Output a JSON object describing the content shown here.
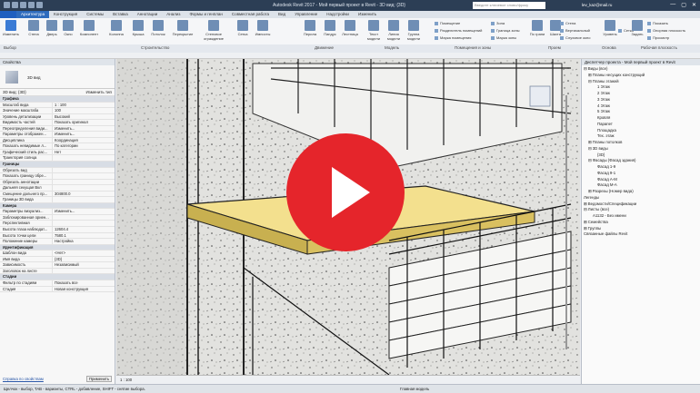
{
  "titlebar": {
    "title": "Autodesk Revit 2017 -    Мой первый проект в Revit - 3D вид: {3D}",
    "search_placeholder": "Введите ключевое слово/фразу",
    "user": "lev_kaz@mail.ru",
    "min": "—",
    "max": "▢",
    "close": "✕"
  },
  "tabs": [
    "Архитектура",
    "Конструкция",
    "Системы",
    "Вставка",
    "Аннотации",
    "Анализ",
    "Формы и генплан",
    "Совместная работа",
    "Вид",
    "Управление",
    "Надстройки",
    "Изменить"
  ],
  "ribbon": {
    "modify": "Изменить",
    "buttons": [
      "Стена",
      "Дверь",
      "Окно",
      "Компонент",
      "Колонна",
      "Крыша",
      "Потолок",
      "Перекрытие",
      "Стеновое ограждение",
      "Сетка",
      "Импосты",
      "Перила",
      "Пандус",
      "Лестница",
      "Текст модели",
      "Линия модели",
      "Группа модели",
      "Помещение",
      "Разделитель помещений",
      "Марка помещения",
      "Зона",
      "Граница зоны",
      "Марка зоны",
      "По грани",
      "Шахта",
      "Стена",
      "Вертикальный",
      "Слуховое окно",
      "Уровень",
      "Сетка",
      "Задать",
      "Показать",
      "Опорная плоскость",
      "Просмотр"
    ],
    "panels": [
      "Выбор",
      "Строительство",
      "Движение",
      "Модель",
      "Помещения и зоны",
      "Проем",
      "Основа",
      "Рабочая плоскость"
    ]
  },
  "properties": {
    "header": "Свойства",
    "type_name": "3D вид",
    "view_selector": "3D вид: {3D}",
    "edit_type": "Изменить тип",
    "rows": [
      {
        "k": "Графика",
        "v": "",
        "group": true
      },
      {
        "k": "Масштаб вида",
        "v": "1 : 100"
      },
      {
        "k": "Значение масштаба",
        "v": "100"
      },
      {
        "k": "Уровень детализации",
        "v": "Высокий"
      },
      {
        "k": "Видимость частей",
        "v": "Показать оригинал"
      },
      {
        "k": "Переопределения види...",
        "v": "Изменить..."
      },
      {
        "k": "Параметры отображен...",
        "v": "Изменить..."
      },
      {
        "k": "Дисциплина",
        "v": "Координация"
      },
      {
        "k": "Показать невидимые л...",
        "v": "По категории"
      },
      {
        "k": "Графический стиль рас...",
        "v": "Нет"
      },
      {
        "k": "Траектория солнца",
        "v": ""
      },
      {
        "k": "Границы",
        "v": "",
        "group": true
      },
      {
        "k": "Обрезать вид",
        "v": ""
      },
      {
        "k": "Показать границу обре...",
        "v": ""
      },
      {
        "k": "Обрезать аннотации",
        "v": ""
      },
      {
        "k": "Дальняя секущая Вкл",
        "v": ""
      },
      {
        "k": "Смещение дальнего пр...",
        "v": "304800.0"
      },
      {
        "k": "Границы 3D вида",
        "v": ""
      },
      {
        "k": "Камера",
        "v": "",
        "group": true
      },
      {
        "k": "Параметры визуализ...",
        "v": "Изменить..."
      },
      {
        "k": "Заблокированная ориен...",
        "v": ""
      },
      {
        "k": "Перспективная",
        "v": ""
      },
      {
        "k": "Высота глаза наблюдат...",
        "v": "12604.4"
      },
      {
        "k": "Высота точки цели",
        "v": "7580.1"
      },
      {
        "k": "Положение камеры",
        "v": "Настройка"
      },
      {
        "k": "Идентификация",
        "v": "",
        "group": true
      },
      {
        "k": "Шаблон вида",
        "v": "<Нет>"
      },
      {
        "k": "Имя вида",
        "v": "{3D}"
      },
      {
        "k": "Зависимость",
        "v": "Независимый"
      },
      {
        "k": "Заголовок на листе",
        "v": ""
      },
      {
        "k": "Стадии",
        "v": "",
        "group": true
      },
      {
        "k": "Фильтр по стадиям",
        "v": "Показать все"
      },
      {
        "k": "Стадия",
        "v": "Новая конструкция"
      }
    ],
    "help": "Справка по свойствам",
    "apply": "Применить"
  },
  "browser": {
    "header": "Диспетчер проекта - Мой первый проект в Revit",
    "items": [
      {
        "t": "⊟ Виды (все)",
        "d": 0
      },
      {
        "t": "⊞ Планы несущих конструкций",
        "d": 1
      },
      {
        "t": "⊟ Планы этажей",
        "d": 1
      },
      {
        "t": "1 Этаж",
        "d": 3
      },
      {
        "t": "2 Этаж",
        "d": 3
      },
      {
        "t": "3 Этаж",
        "d": 3
      },
      {
        "t": "4 Этаж",
        "d": 3
      },
      {
        "t": "5 Этаж",
        "d": 3
      },
      {
        "t": "Кровля",
        "d": 3
      },
      {
        "t": "Парапет",
        "d": 3
      },
      {
        "t": "Площадка",
        "d": 3
      },
      {
        "t": "Тех. этаж",
        "d": 3
      },
      {
        "t": "⊞ Планы потолков",
        "d": 1
      },
      {
        "t": "⊟ 3D виды",
        "d": 1
      },
      {
        "t": "{3D}",
        "d": 3
      },
      {
        "t": "⊟ Фасады (Фасад здания)",
        "d": 1
      },
      {
        "t": "Фасад 1-9",
        "d": 3
      },
      {
        "t": "Фасад 9-1",
        "d": 3
      },
      {
        "t": "Фасад А-М",
        "d": 3
      },
      {
        "t": "Фасад М-А",
        "d": 3
      },
      {
        "t": "⊞ Разрезы (Номер вида)",
        "d": 1
      },
      {
        "t": "Легенды",
        "d": 0
      },
      {
        "t": "⊞ Ведомости/Спецификации",
        "d": 0
      },
      {
        "t": "⊟ Листы (все)",
        "d": 0
      },
      {
        "t": "А1132 - Без имени",
        "d": 2
      },
      {
        "t": "⊞ Семейства",
        "d": 0
      },
      {
        "t": "⊞ Группы",
        "d": 0
      },
      {
        "t": "Связанные файлы Revit",
        "d": 0
      }
    ]
  },
  "viewcontrol": {
    "scale": "1 : 100"
  },
  "status": {
    "text": "Щелчок - выбор, TAB - варианты, CTRL - добавление, SHIFT - снятие выбора.",
    "model": "Главная модель"
  }
}
